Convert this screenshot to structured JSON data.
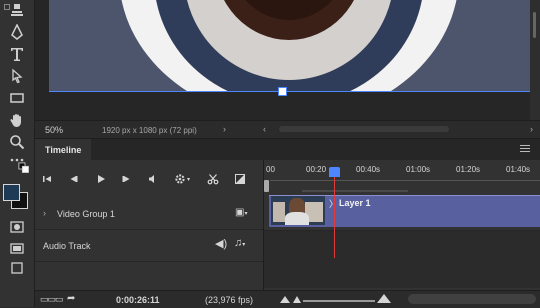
{
  "status": {
    "zoom": "50%",
    "doc_info": "1920 px x 1080 px (72 ppi)"
  },
  "timeline": {
    "tab_label": "Timeline",
    "ruler_ticks": [
      "00",
      "00:20",
      "00:40s",
      "01:00s",
      "01:20s",
      "01:40s"
    ],
    "tracks": [
      {
        "label": "Video Group 1"
      },
      {
        "label": "Audio Track"
      }
    ],
    "clip_label": "Layer 1"
  },
  "bottom": {
    "timecode": "0:00:26:11",
    "fps": "(23,976 fps)"
  },
  "colors": {
    "accent": "#4d86ff",
    "clip": "#5860a0",
    "playhead": "#e23a3a"
  }
}
